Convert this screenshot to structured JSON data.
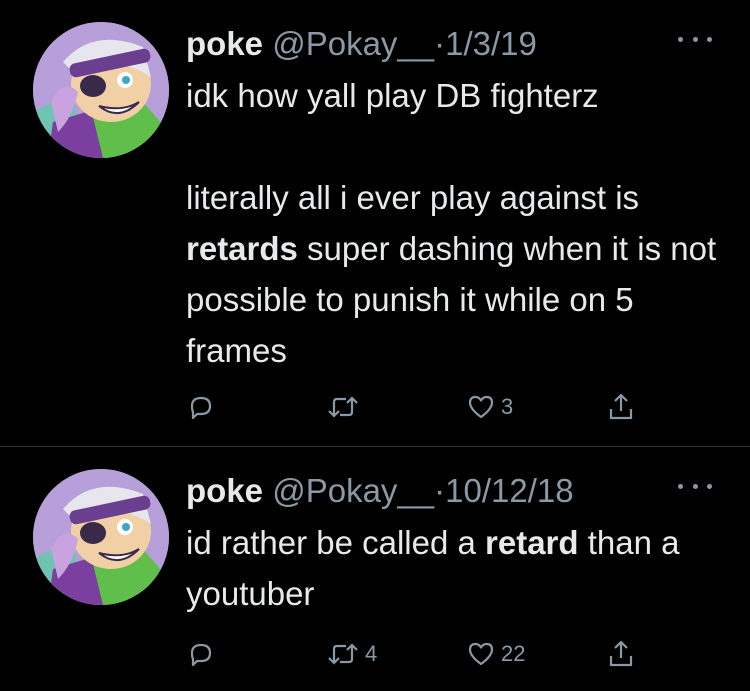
{
  "tweets": [
    {
      "author": {
        "name": "poke",
        "handle": "@Pokay__"
      },
      "separator": "·",
      "date": "1/3/19",
      "text": {
        "line1": "idk how yall play DB fighterz",
        "para2_before": "literally all i ever play against is ",
        "para2_bold": "retards",
        "para2_after": " super dashing when it is not possible to punish it while on 5 frames"
      },
      "actions": {
        "reply": {
          "icon": "reply-icon",
          "count": ""
        },
        "retweet": {
          "icon": "retweet-icon",
          "count": ""
        },
        "like": {
          "icon": "heart-icon",
          "count": "3"
        },
        "share": {
          "icon": "share-icon"
        }
      }
    },
    {
      "author": {
        "name": "poke",
        "handle": "@Pokay__"
      },
      "separator": "·",
      "date": "10/12/18",
      "text": {
        "before": "id rather be called a ",
        "bold": "retard",
        "after": " than a youtuber"
      },
      "actions": {
        "reply": {
          "icon": "reply-icon",
          "count": ""
        },
        "retweet": {
          "icon": "retweet-icon",
          "count": "4"
        },
        "like": {
          "icon": "heart-icon",
          "count": "22"
        },
        "share": {
          "icon": "share-icon"
        }
      }
    }
  ],
  "colors": {
    "background": "#000000",
    "primary_text": "#e7e9ea",
    "secondary_text": "#8b98a5",
    "divider": "#2f3336"
  }
}
